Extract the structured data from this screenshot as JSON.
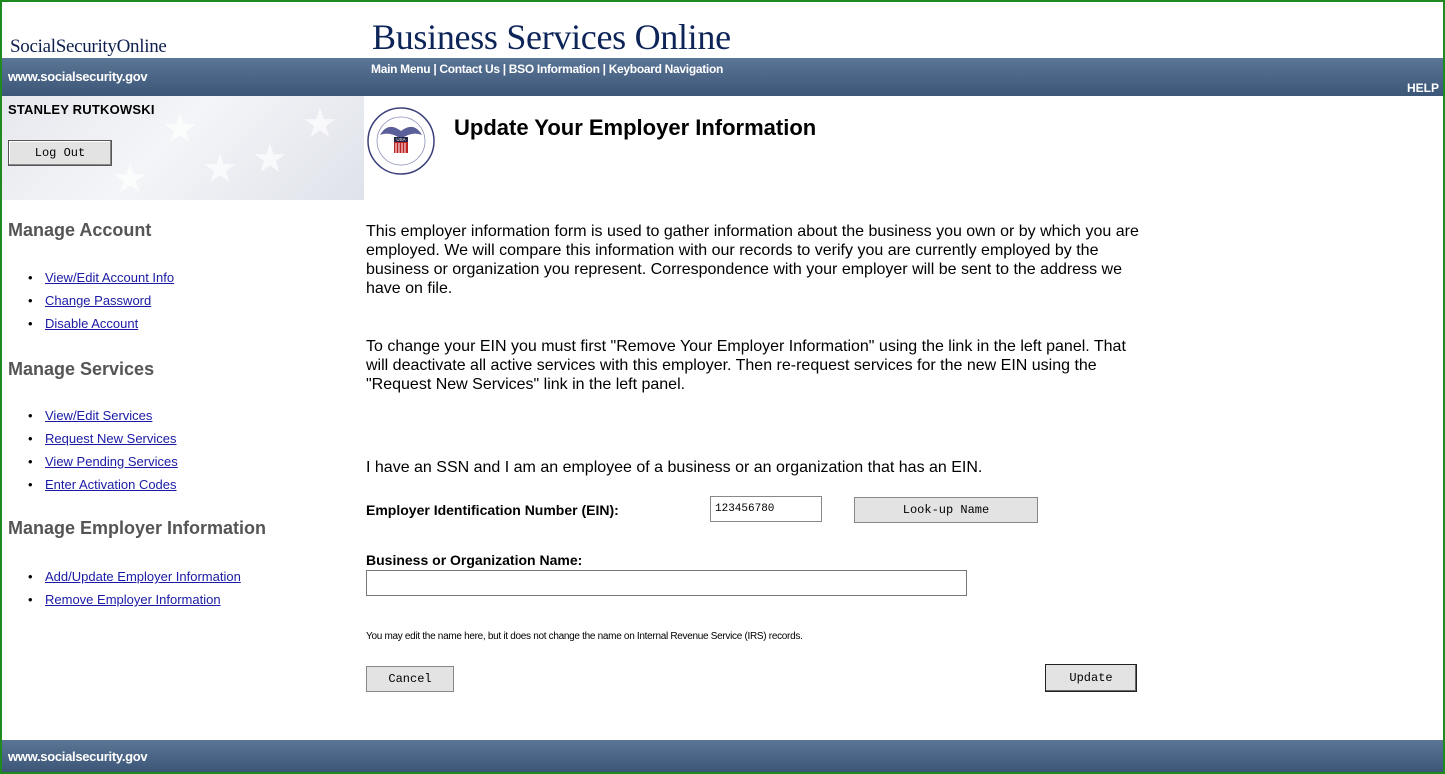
{
  "header": {
    "brand_left": "SocialSecurityOnline",
    "title": "Business Services Online",
    "site_url": "www.socialsecurity.gov",
    "nav": [
      "Main Menu",
      "Contact Us",
      "BSO Information",
      "Keyboard Navigation"
    ],
    "help": "HELP"
  },
  "user": {
    "name": "STANLEY RUTKOWSKI",
    "logout_label": "Log Out"
  },
  "sidebar": {
    "sections": [
      {
        "heading": "Manage Account",
        "links": [
          "View/Edit Account Info",
          "Change Password",
          "Disable Account"
        ]
      },
      {
        "heading": "Manage Services",
        "links": [
          "View/Edit Services",
          "Request New Services",
          "View Pending Services",
          "Enter Activation Codes"
        ]
      },
      {
        "heading": "Manage Employer Information",
        "links": [
          "Add/Update Employer Information",
          "Remove Employer Information"
        ]
      }
    ]
  },
  "main": {
    "seal_text": "USA",
    "page_title": "Update Your Employer Information",
    "para1": "This employer information form is used to gather information about the business you own or by which you are employed. We will compare this information with our records to verify you are currently employed by the business or organization you represent. Correspondence with your employer will be sent to the address we have on file.",
    "para2": "To change your EIN you must first \"Remove Your Employer Information\" using the link in the left panel. That will deactivate all active services with this employer. Then re-request services for the new EIN using the \"Request New Services\" link in the left panel.",
    "para3": "I have an SSN and I am an employee of a business or an organization that has an EIN.",
    "ein_label": "Employer Identification Number (EIN):",
    "ein_value": "123456780",
    "lookup_label": "Look-up Name",
    "bizname_label": "Business or Organization Name:",
    "bizname_value": "",
    "note": "You may edit the name here, but it does not change the name on Internal Revenue Service (IRS) records.",
    "cancel_label": "Cancel",
    "update_label": "Update"
  },
  "footer": {
    "site_url": "www.socialsecurity.gov"
  },
  "colors": {
    "bar_blue": "#4a6587",
    "frame_green": "#1f8a1f",
    "link_blue": "#1a1aa6",
    "title_navy": "#0d2459"
  }
}
